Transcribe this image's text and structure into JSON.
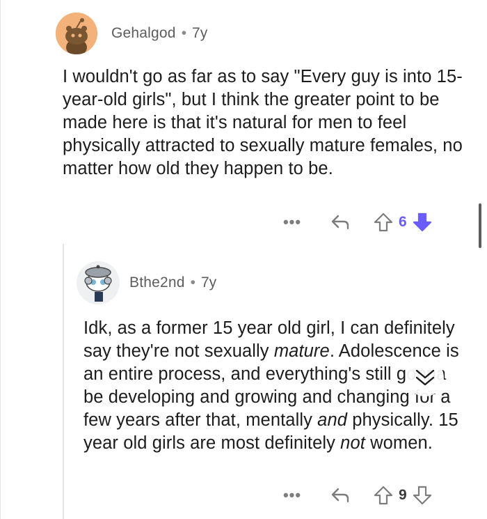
{
  "comments": [
    {
      "username": "Gehalgod",
      "separator": "•",
      "age": "7y",
      "text": "I wouldn't go as far as to say \"Every guy is into 15-year-old girls\", but I think the greater point to be made here is that it's natural for men to feel physically attracted to sexually mature females, no matter how old they happen to be.",
      "more_label": "•••",
      "score": "6",
      "vote_state": "downvoted",
      "avatar_icon": "snoo-avatar-orange"
    },
    {
      "username": "Bthe2nd",
      "separator": "•",
      "age": "7y",
      "text_parts": {
        "p1": "Idk, as a former 15 year old girl, I can definitely say they're not sexually ",
        "p2": "mature",
        "p3": ". Adolescence is an entire process, and everything's still gonna be developing and growing and changing for a few years after that, mentally ",
        "p4": "and",
        "p5": " physically. 15 year old girls are most definitely ",
        "p6": "not",
        "p7": " women."
      },
      "more_label": "•••",
      "score": "9",
      "vote_state": "none",
      "avatar_icon": "snoo-avatar-custom"
    }
  ],
  "colors": {
    "downvote": "#6a5cff",
    "icon_gray": "#7c7c7c",
    "avatar_bg_orange": "#f2b27a"
  }
}
